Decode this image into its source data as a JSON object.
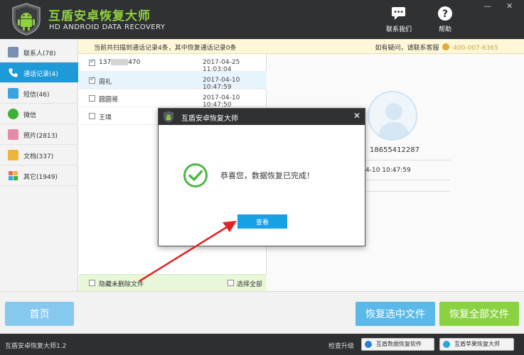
{
  "app": {
    "title": "互盾安卓恢复大师",
    "subtitle": "HD ANDROID DATA RECOVERY",
    "contact_label": "联系我们",
    "help_label": "帮助"
  },
  "info_strip": {
    "scan_summary": "当前共扫描到通话记录4条，其中恢复通话记录0条",
    "help_prefix": "如有疑问，请联系客服",
    "phone": "400-007-6365"
  },
  "sidebar": {
    "items": [
      {
        "label": "联系人(78)",
        "icon": "contacts-icon",
        "color": "#7b8fb3"
      },
      {
        "label": "通话记录(4)",
        "icon": "call-log-icon",
        "color": "#ffffff"
      },
      {
        "label": "短信(46)",
        "icon": "sms-icon",
        "color": "#3aa3e0"
      },
      {
        "label": "微信",
        "icon": "wechat-icon",
        "color": "#3cb034"
      },
      {
        "label": "照片(2813)",
        "icon": "photo-icon",
        "color": "#e78aa8"
      },
      {
        "label": "文档(337)",
        "icon": "document-icon",
        "color": "#f1b43a"
      },
      {
        "label": "其它(1949)",
        "icon": "other-icon",
        "color": "#e86a5a"
      }
    ]
  },
  "call_list": {
    "rows": [
      {
        "name_prefix": "137",
        "name_suffix": "470",
        "time": "2017-04-25 11:03:04",
        "checked": true
      },
      {
        "name": "周礼",
        "time": "2017-04-10 10:47:59",
        "checked": true
      },
      {
        "name": "圆圆哥",
        "time": "2017-04-10 10:47:50",
        "checked": false
      },
      {
        "name": "王境",
        "time": "",
        "checked": false
      }
    ],
    "hide_undeleted_label": "隐藏未删除文件",
    "select_all_label": "选择全部"
  },
  "detail": {
    "phone": "18655412287",
    "time_partial": "4-10 10:47:59"
  },
  "actions": {
    "home": "首页",
    "recover_selected": "恢复选中文件",
    "recover_all": "恢复全部文件"
  },
  "status": {
    "version": "互盾安卓恢复大师1.2",
    "check_upgrade": "检查升级",
    "promo1": "互盾数据恢复软件",
    "promo2": "互盾苹果恢复大师"
  },
  "dialog": {
    "title": "互盾安卓恢复大师",
    "message": "恭喜您，数据恢复已完成！",
    "view_button": "查看",
    "close": "✕"
  },
  "colors": {
    "titlebar": "#2f3133",
    "accent_green": "#8fd13f",
    "active_blue": "#1e9ad8",
    "annotation_red": "#e02424"
  }
}
